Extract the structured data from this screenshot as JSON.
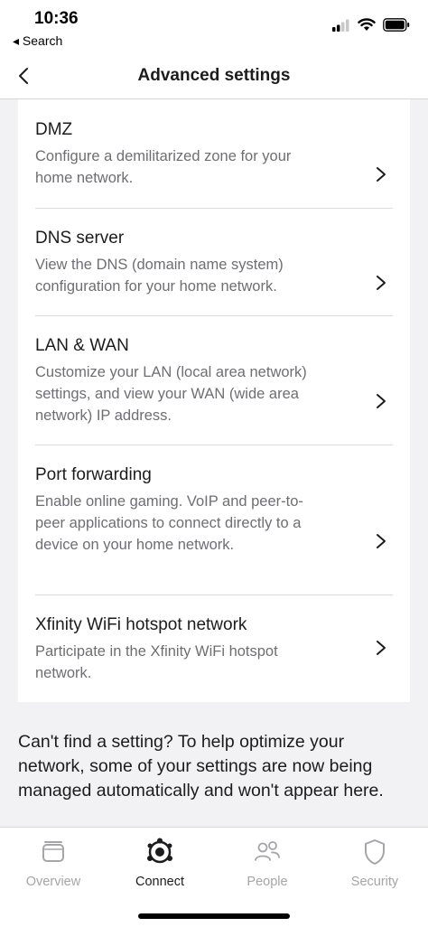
{
  "status_bar": {
    "time": "10:36",
    "back_app": "◂ Search"
  },
  "nav": {
    "title": "Advanced settings"
  },
  "settings": [
    {
      "title": "DMZ",
      "description": "Configure a demilitarized zone for your home network."
    },
    {
      "title": "DNS server",
      "description": "View the DNS (domain name system) configuration for your home network."
    },
    {
      "title": "LAN & WAN",
      "description": "Customize your LAN (local area network) settings, and view your WAN (wide area network) IP address."
    },
    {
      "title": "Port forwarding",
      "description": "Enable online gaming. VoIP and peer-to-peer applications to connect directly to a device on your home network."
    },
    {
      "title": "Xfinity WiFi hotspot network",
      "description": "Participate in the Xfinity WiFi hotspot network."
    }
  ],
  "footer_note": "Can't find a setting? To help optimize your network, some of your settings are now being managed automatically and won't appear here.",
  "tabs": [
    {
      "label": "Overview",
      "icon": "overview-icon"
    },
    {
      "label": "Connect",
      "icon": "connect-icon"
    },
    {
      "label": "People",
      "icon": "people-icon"
    },
    {
      "label": "Security",
      "icon": "shield-icon"
    }
  ],
  "active_tab": "Connect",
  "colors": {
    "text": "#1c1c1e",
    "secondary_text": "#6e6e73",
    "inactive_tab": "#a5a5aa",
    "background": "#f2f2f4"
  }
}
